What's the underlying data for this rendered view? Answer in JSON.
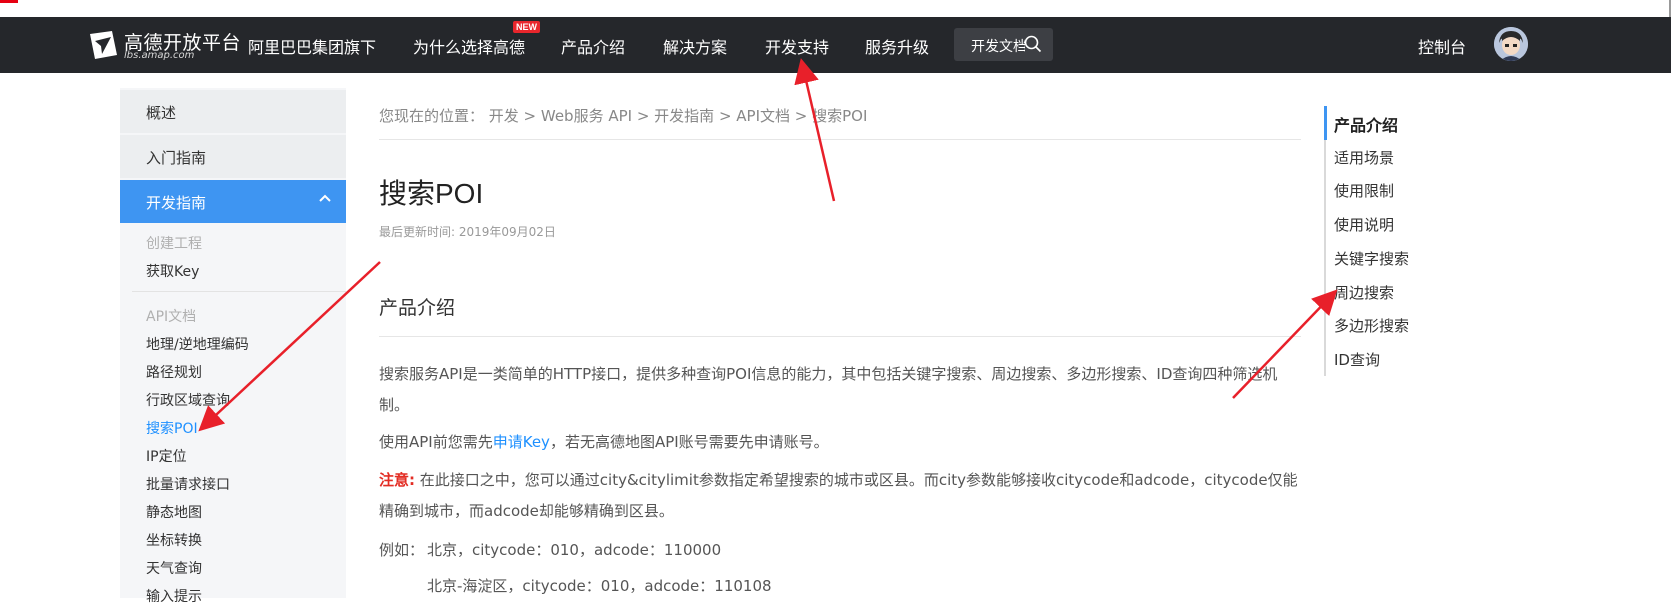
{
  "nav": {
    "logo_name": "高德开放平台",
    "logo_sub": "lbs.amap.com",
    "items": [
      "阿里巴巴集团旗下",
      "为什么选择高德",
      "产品介绍",
      "解决方案",
      "开发支持",
      "服务升级"
    ],
    "new_badge": "NEW",
    "search_text": "开发文档",
    "console": "控制台"
  },
  "sidebar": {
    "top_items": [
      "概述",
      "入门指南",
      "开发指南"
    ],
    "group1_title": "创建工程",
    "group1_links": [
      "获取Key"
    ],
    "group2_title": "API文档",
    "group2_links": [
      "地理/逆地理编码",
      "路径规划",
      "行政区域查询",
      "搜索POI",
      "IP定位",
      "批量请求接口",
      "静态地图",
      "坐标转换",
      "天气查询",
      "输入提示"
    ],
    "current": "搜索POI"
  },
  "content": {
    "breadcrumb": "您现在的位置：  开发 > Web服务 API > 开发指南 > API文档 > 搜索POI",
    "title": "搜索POI",
    "updated": "最后更新时间: 2019年09月02日",
    "section_title": "产品介绍",
    "para1": "搜索服务API是一类简单的HTTP接口，提供多种查询POI信息的能力，其中包括关键字搜索、周边搜索、多边形搜索、ID查询四种筛选机制。",
    "para2_before": "使用API前您需先",
    "para2_link": "申请Key",
    "para2_after": "，若无高德地图API账号需要先申请账号。",
    "note_label": "注意:",
    "note_text": "在此接口之中，您可以通过city&citylimit参数指定希望搜索的城市或区县。而city参数能够接收citycode和adcode，citycode仅能精确到城市，而adcode却能够精确到区县。",
    "example_label": "例如：",
    "example1": "北京，citycode：010，adcode：110000",
    "example2": "北京-海淀区，citycode：010，adcode：110108"
  },
  "toc": {
    "items": [
      "产品介绍",
      "适用场景",
      "使用限制",
      "使用说明",
      "关键字搜索",
      "周边搜索",
      "多边形搜索",
      "ID查询"
    ]
  },
  "colors": {
    "navbar": "#25272b",
    "accent": "#3e95f2",
    "annotation_arrow": "#e8202a",
    "warning": "#e32d24"
  }
}
